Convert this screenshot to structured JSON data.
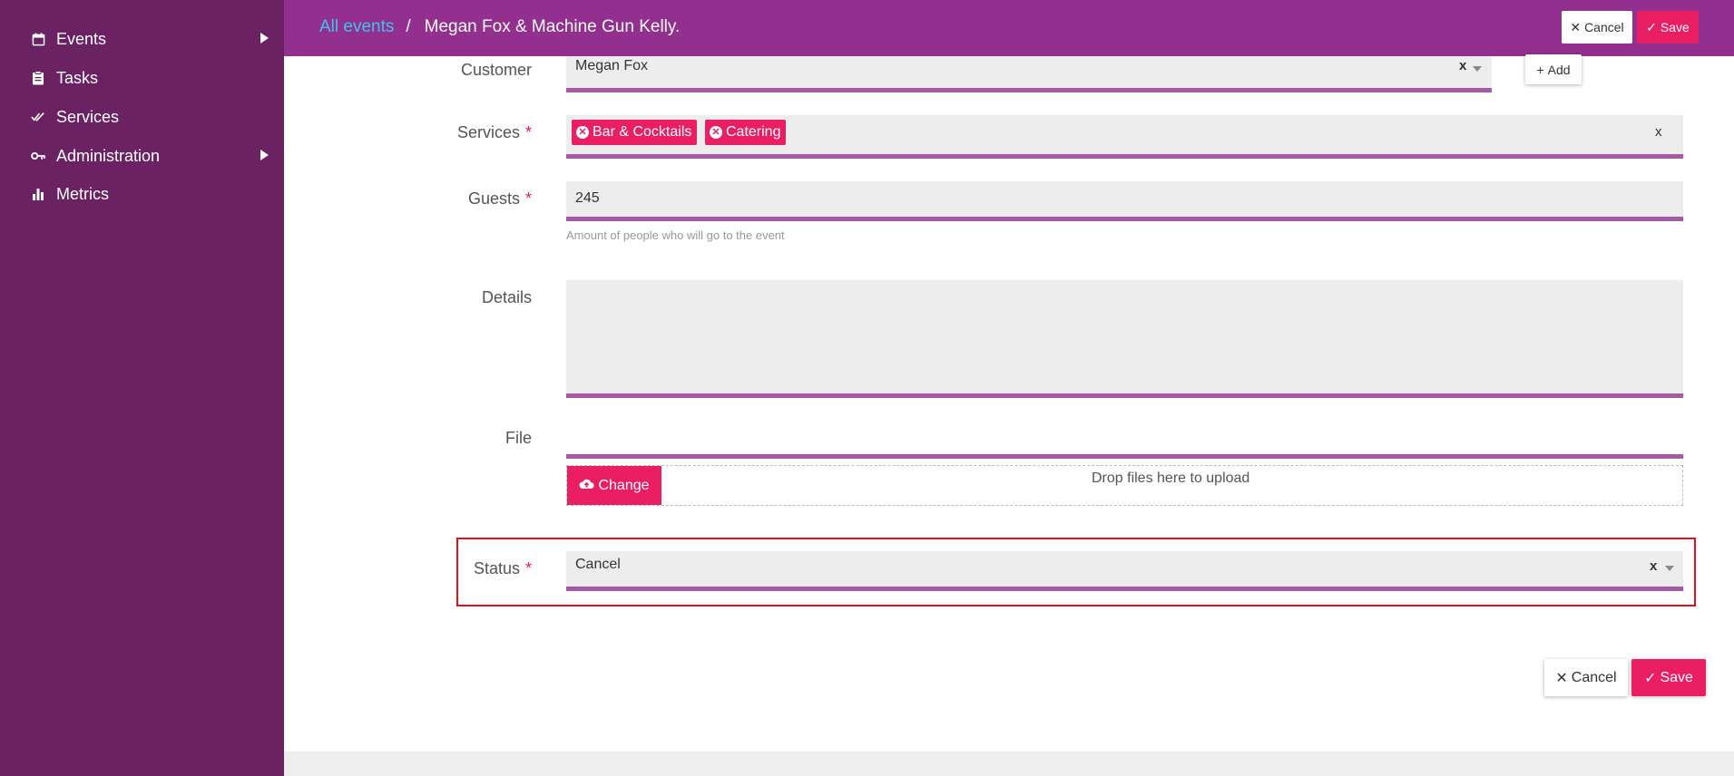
{
  "sidebar": {
    "items": [
      {
        "label": "Events",
        "icon": "calendar-icon",
        "has_submenu": true
      },
      {
        "label": "Tasks",
        "icon": "clipboard-icon",
        "has_submenu": false
      },
      {
        "label": "Services",
        "icon": "double-check-icon",
        "has_submenu": false
      },
      {
        "label": "Administration",
        "icon": "key-icon",
        "has_submenu": true
      },
      {
        "label": "Metrics",
        "icon": "bar-chart-icon",
        "has_submenu": false
      }
    ]
  },
  "header": {
    "breadcrumb_link": "All events",
    "separator": "/",
    "current": "Megan Fox & Machine Gun Kelly.",
    "cancel_label": "Cancel",
    "save_label": "Save"
  },
  "form": {
    "customer": {
      "label": "Customer",
      "value": "Megan Fox",
      "clear": "x",
      "add_label": "Add"
    },
    "services": {
      "label": "Services",
      "required_mark": "*",
      "tags": [
        "Bar & Cocktails",
        "Catering"
      ],
      "clear": "x"
    },
    "guests": {
      "label": "Guests",
      "required_mark": "*",
      "value": "245",
      "help": "Amount of people who will go to the event"
    },
    "details": {
      "label": "Details",
      "value": ""
    },
    "file": {
      "label": "File",
      "change_label": "Change",
      "drop_text": "Drop files here to upload"
    },
    "status": {
      "label": "Status",
      "required_mark": "*",
      "value": "Cancel",
      "clear": "x"
    }
  },
  "footer_actions": {
    "cancel_label": "Cancel",
    "save_label": "Save"
  },
  "colors": {
    "sidebar_bg": "#6a2263",
    "header_bg": "#93308f",
    "accent": "#ea1e63",
    "link": "#3fc1f0",
    "field_underline": "#a45aa6",
    "highlight": "#e50e1c"
  }
}
